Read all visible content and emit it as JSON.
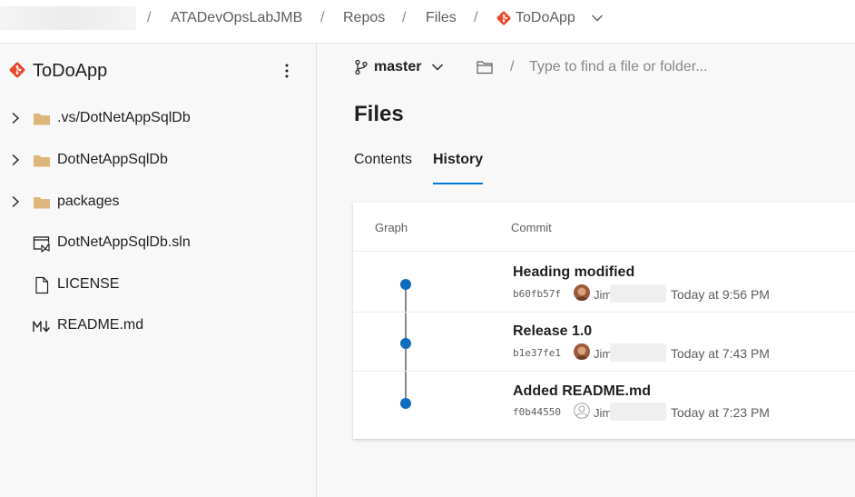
{
  "breadcrumb": {
    "project": "ATADevOpsLabJMB",
    "repos": "Repos",
    "files": "Files",
    "repository": "ToDoApp",
    "separator": "/"
  },
  "sidebar": {
    "repo_name": "ToDoApp",
    "items": [
      {
        "label": ".vs/DotNetAppSqlDb",
        "type": "folder",
        "icon": "folder-icon",
        "expandable": true
      },
      {
        "label": "DotNetAppSqlDb",
        "type": "folder",
        "icon": "folder-icon",
        "expandable": true
      },
      {
        "label": "packages",
        "type": "folder",
        "icon": "folder-icon",
        "expandable": true
      },
      {
        "label": "DotNetAppSqlDb.sln",
        "type": "file",
        "icon": "visual-studio-solution-icon",
        "expandable": false
      },
      {
        "label": "LICENSE",
        "type": "file",
        "icon": "document-icon",
        "expandable": false
      },
      {
        "label": "README.md",
        "type": "file",
        "icon": "markdown-icon",
        "expandable": false
      }
    ]
  },
  "main": {
    "branch": "master",
    "path_separator": "/",
    "path_search_placeholder": "Type to find a file or folder...",
    "title": "Files",
    "tabs": [
      {
        "label": "Contents",
        "active": false
      },
      {
        "label": "History",
        "active": true
      }
    ],
    "history": {
      "columns": {
        "graph": "Graph",
        "commit": "Commit"
      },
      "commits": [
        {
          "message": "Heading modified",
          "hash": "b60fb57f",
          "author": "Jim",
          "time": "Today at 9:56 PM",
          "avatar": "photo"
        },
        {
          "message": "Release 1.0",
          "hash": "b1e37fe1",
          "author": "Jim",
          "time": "Today at 7:43 PM",
          "avatar": "photo"
        },
        {
          "message": "Added README.md",
          "hash": "f0b44550",
          "author": "Jim",
          "time": "Today at 7:23 PM",
          "avatar": "placeholder"
        }
      ]
    }
  },
  "colors": {
    "git_accent": "#e8492d",
    "active_tab": "#0078d4",
    "graph_node": "#0f6cbd",
    "folder": "#dcb67a"
  }
}
